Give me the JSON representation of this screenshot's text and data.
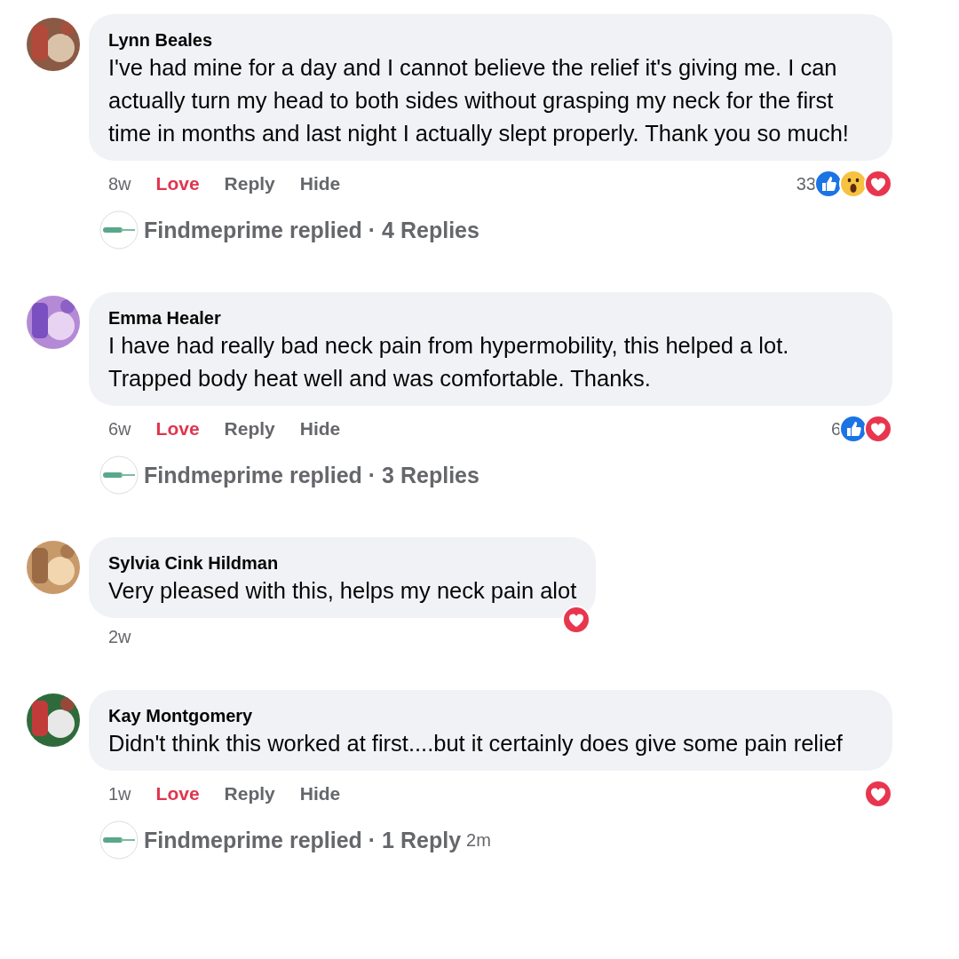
{
  "comments": [
    {
      "author": "Lynn Beales",
      "text": "I've had mine for a day and I cannot believe the relief it's giving me. I can actually turn my head to both sides without grasping my neck for the first time in months and last night I actually slept properly. Thank you so much!",
      "time": "8w",
      "actions": [
        {
          "label": "Love",
          "kind": "love"
        },
        {
          "label": "Reply",
          "kind": "reply"
        },
        {
          "label": "Hide",
          "kind": "hide"
        }
      ],
      "reactions": {
        "count": "33",
        "icons": [
          {
            "kind": "like"
          },
          {
            "kind": "wow"
          },
          {
            "kind": "love"
          }
        ],
        "overlap": false
      },
      "replies": {
        "summary": "Findmeprime replied · 4 Replies"
      }
    },
    {
      "author": "Emma Healer",
      "text": "I have had really bad neck pain from hypermobility, this helped a lot. Trapped body heat well and was comfortable. Thanks.",
      "time": "6w",
      "actions": [
        {
          "label": "Love",
          "kind": "love"
        },
        {
          "label": "Reply",
          "kind": "reply"
        },
        {
          "label": "Hide",
          "kind": "hide"
        }
      ],
      "reactions": {
        "count": "6",
        "icons": [
          {
            "kind": "like"
          },
          {
            "kind": "love"
          }
        ],
        "overlap": false
      },
      "replies": {
        "summary": "Findmeprime replied · 3 Replies"
      }
    },
    {
      "author": "Sylvia Cink Hildman",
      "text": "Very pleased with this, helps my neck pain alot",
      "time": "2w",
      "reactions": {
        "icons": [
          {
            "kind": "love"
          }
        ],
        "overlap": true
      }
    },
    {
      "author": "Kay Montgomery",
      "text": "Didn't think this worked at first....but it certainly does give some pain relief",
      "time": "1w",
      "actions": [
        {
          "label": "Love",
          "kind": "love"
        },
        {
          "label": "Reply",
          "kind": "reply"
        },
        {
          "label": "Hide",
          "kind": "hide"
        }
      ],
      "reactions": {
        "icons": [
          {
            "kind": "love"
          }
        ],
        "overlap": false
      },
      "replies": {
        "summary": "Findmeprime replied · 1 Reply",
        "time": "2m"
      }
    }
  ]
}
